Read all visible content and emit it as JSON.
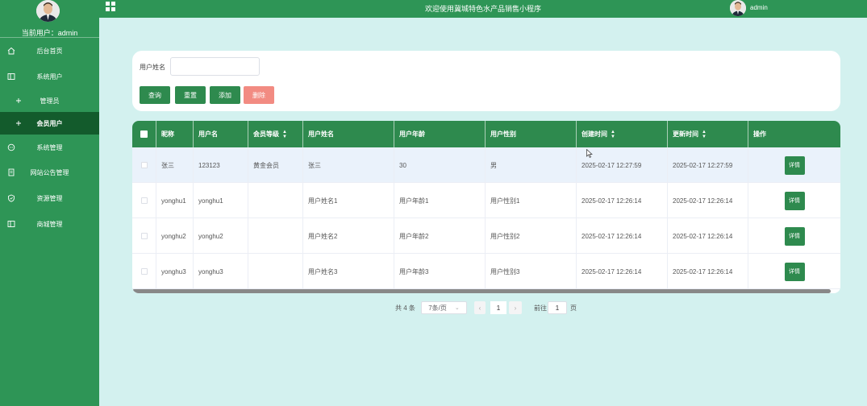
{
  "sidebar": {
    "current_user": "当前用户：admin",
    "items": [
      {
        "label": "后台首页",
        "icon": "home-icon"
      },
      {
        "label": "系统用户",
        "icon": "columns-icon"
      },
      {
        "label": "管理员",
        "icon": "plus-icon"
      },
      {
        "label": "会员用户",
        "icon": "plus-icon"
      },
      {
        "label": "系统管理",
        "icon": "chat-icon"
      },
      {
        "label": "网站公告管理",
        "icon": "document-icon"
      },
      {
        "label": "资源管理",
        "icon": "shield-icon"
      },
      {
        "label": "商城管理",
        "icon": "columns-icon"
      }
    ]
  },
  "header": {
    "title": "欢迎使用冀城特色水产品销售小程序",
    "username": "admin"
  },
  "search": {
    "label": "用户姓名",
    "placeholder": "",
    "value": "",
    "buttons": {
      "query": "查询",
      "reset": "重置",
      "add": "添加",
      "delete": "删除"
    }
  },
  "table": {
    "columns": [
      "昵称",
      "用户名",
      "会员等级",
      "用户姓名",
      "用户年龄",
      "用户性别",
      "创建时间",
      "更新时间",
      "操作"
    ],
    "rows": [
      {
        "nickname": "张三",
        "username": "123123",
        "level": "黄金会员",
        "name": "张三",
        "age": "30",
        "gender": "男",
        "created": "2025-02-17 12:27:59",
        "updated": "2025-02-17 12:27:59",
        "action": "详情"
      },
      {
        "nickname": "yonghu1",
        "username": "yonghu1",
        "level": "",
        "name": "用户姓名1",
        "age": "用户年龄1",
        "gender": "用户性别1",
        "created": "2025-02-17 12:26:14",
        "updated": "2025-02-17 12:26:14",
        "action": "详情"
      },
      {
        "nickname": "yonghu2",
        "username": "yonghu2",
        "level": "",
        "name": "用户姓名2",
        "age": "用户年龄2",
        "gender": "用户性别2",
        "created": "2025-02-17 12:26:14",
        "updated": "2025-02-17 12:26:14",
        "action": "详情"
      },
      {
        "nickname": "yonghu3",
        "username": "yonghu3",
        "level": "",
        "name": "用户姓名3",
        "age": "用户年龄3",
        "gender": "用户性别3",
        "created": "2025-02-17 12:26:14",
        "updated": "2025-02-17 12:26:14",
        "action": "详情"
      }
    ]
  },
  "pagination": {
    "total": "共 4 条",
    "page_size": "7条/页",
    "current_page": "1",
    "goto_label": "前往",
    "goto_value": "1",
    "page_suffix": "页"
  },
  "colors": {
    "primary": "#2e8a4e",
    "sidebar": "#2e9556",
    "active": "#135b2c",
    "danger": "#f28b82",
    "background": "#d3f1ef"
  }
}
